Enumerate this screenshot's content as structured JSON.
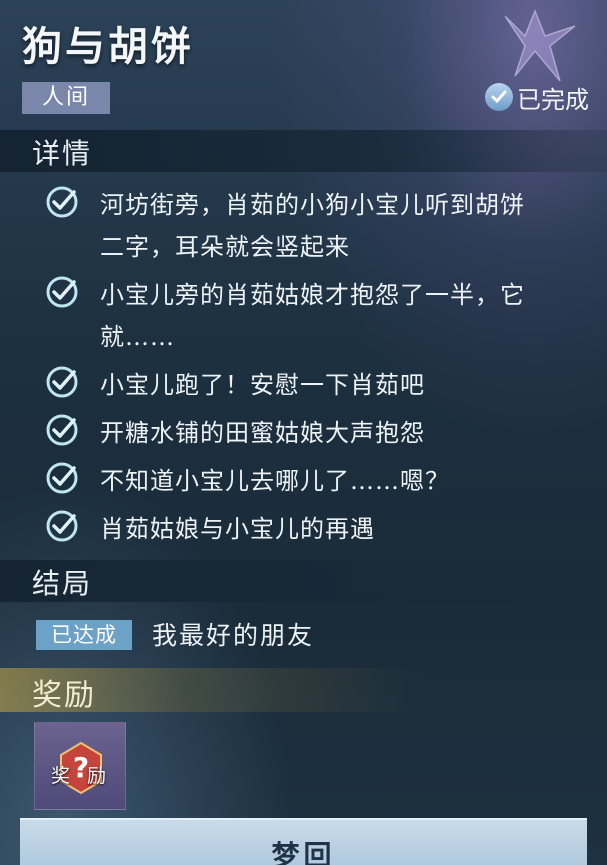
{
  "quest": {
    "title": "狗与胡饼",
    "realm": "人间",
    "status": "已完成"
  },
  "details": {
    "heading": "详情",
    "tasks": [
      {
        "line1": "河坊街旁，肖茹的小狗小宝儿听到胡饼",
        "line2": "二字，耳朵就会竖起来"
      },
      {
        "line1": "小宝儿旁的肖茹姑娘才抱怨了一半，它",
        "line2": "就……"
      },
      {
        "line1": "小宝儿跑了！安慰一下肖茹吧"
      },
      {
        "line1": "开糖水铺的田蜜姑娘大声抱怨"
      },
      {
        "line1": "不知道小宝儿去哪儿了……嗯？"
      },
      {
        "line1": "肖茹姑娘与小宝儿的再遇"
      }
    ]
  },
  "ending": {
    "heading": "结局",
    "tag": "已达成",
    "name": "我最好的朋友"
  },
  "reward": {
    "heading": "奖励",
    "item_label_left": "奖",
    "item_label_right": "励",
    "item_icon": "question-mark-icon"
  },
  "action": {
    "dream_label": "梦回"
  },
  "colors": {
    "realm_tag": "#7b86ab",
    "ending_tag": "#6da2c8",
    "check": "#bfe4f2",
    "button": "#b9d0e2"
  }
}
